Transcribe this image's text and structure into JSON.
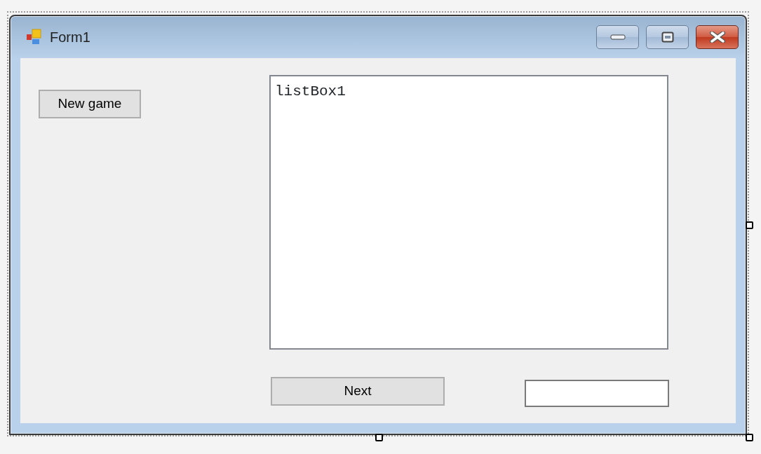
{
  "window": {
    "title": "Form1"
  },
  "controls": [
    {
      "kind": "button",
      "text": "New game"
    },
    {
      "kind": "listbox",
      "text": "listBox1"
    },
    {
      "kind": "button",
      "text": "Next"
    },
    {
      "kind": "textbox"
    }
  ]
}
